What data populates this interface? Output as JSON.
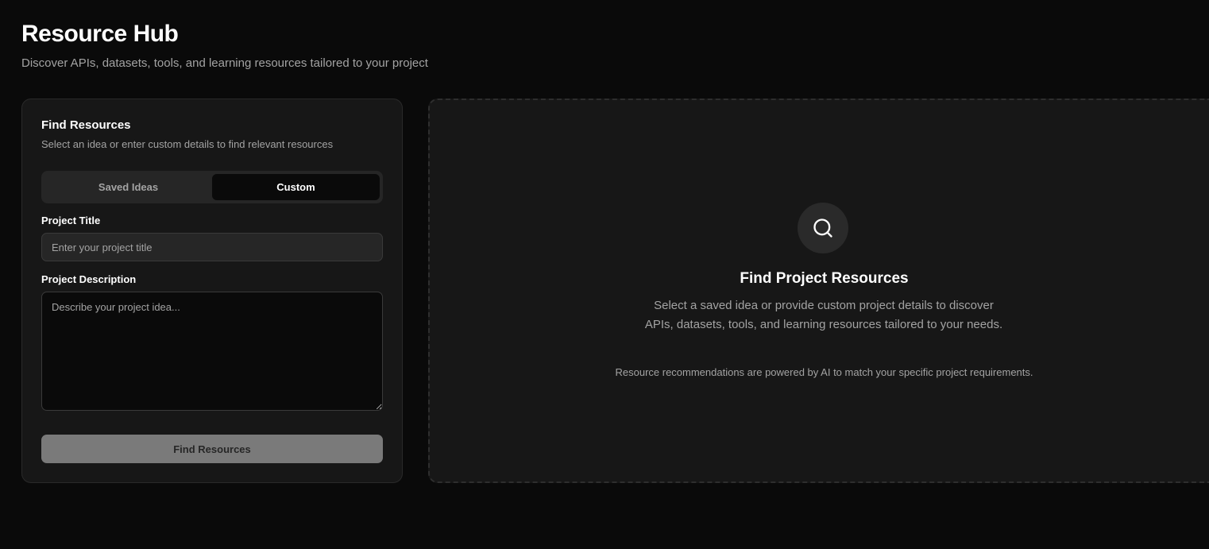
{
  "header": {
    "title": "Resource Hub",
    "subtitle": "Discover APIs, datasets, tools, and learning resources tailored to your project"
  },
  "finder": {
    "title": "Find Resources",
    "subtitle": "Select an idea or enter custom details to find relevant resources",
    "tabs": [
      {
        "label": "Saved Ideas",
        "active": false
      },
      {
        "label": "Custom",
        "active": true
      }
    ],
    "project_title": {
      "label": "Project Title",
      "value": "",
      "placeholder": "Enter your project title"
    },
    "project_description": {
      "label": "Project Description",
      "value": "",
      "placeholder": "Describe your project idea..."
    },
    "submit_label": "Find Resources"
  },
  "empty_state": {
    "icon": "search-icon",
    "title": "Find Project Resources",
    "description": "Select a saved idea or provide custom project details to discover APIs, datasets, tools, and learning resources tailored to your needs.",
    "note": "Resource recommendations are powered by AI to match your specific project requirements."
  },
  "colors": {
    "background": "#0a0a0a",
    "card": "#171717",
    "muted_text": "#a3a3a3",
    "disabled_button": "#7a7a7a"
  }
}
